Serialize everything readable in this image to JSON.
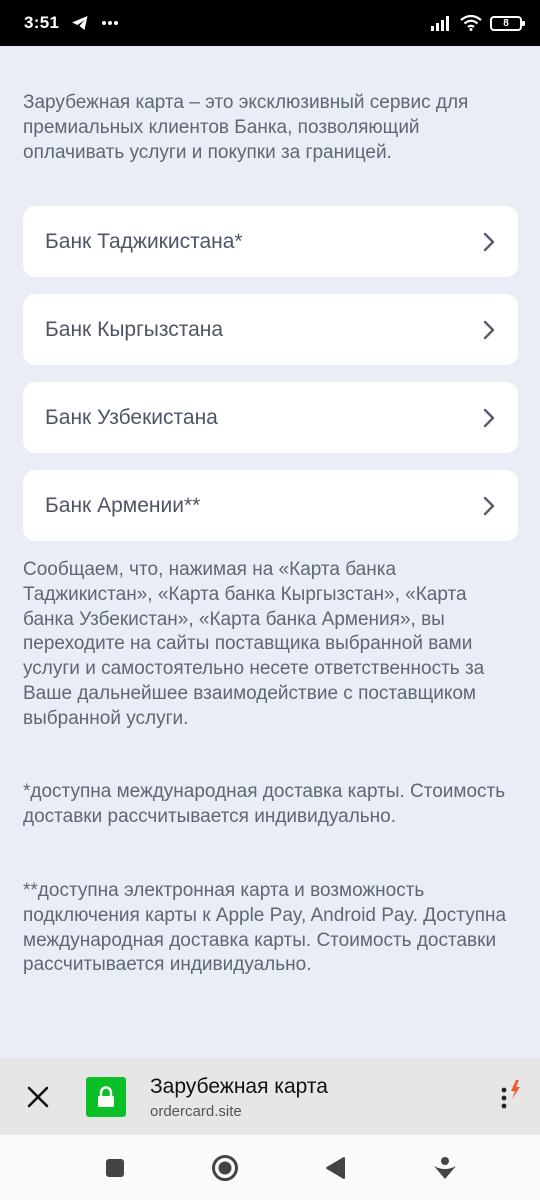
{
  "status_bar": {
    "time": "3:51",
    "battery": "8",
    "icons": [
      "telegram-icon",
      "more-icon",
      "signal-icon",
      "wifi-icon",
      "battery-icon"
    ]
  },
  "intro_text": "Зарубежная карта – это эксклюзивный сервис для премиальных клиентов Банка, позволяющий оплачивать услуги и покупки за границей.",
  "banks": [
    {
      "label": "Банк Таджикистана*"
    },
    {
      "label": "Банк Кыргызстана"
    },
    {
      "label": "Банк Узбекистана"
    },
    {
      "label": "Банк Армении**"
    }
  ],
  "notice": {
    "main": "Сообщаем, что, нажимая на «Карта банка Таджикистан», «Карта банка Кыргызстан», «Карта банка Узбекистан», «Карта банка Армения», вы переходите на сайты поставщика выбранной вами услуги и самостоятельно несете ответственность за Ваше дальнейшее взаимодействие с поставщиком выбранной услуги.",
    "footnote1": "*доступна международная доставка карты. Стоимость доставки рассчитывается индивидуально.",
    "footnote2": "**доступна электронная карта и возможность подключения карты к Apple Pay, Android Pay. Доступна международная доставка карты. Стоимость доставки рассчитывается индивидуально."
  },
  "address_bar": {
    "title": "Зарубежная карта",
    "url": "ordercard.site"
  },
  "colors": {
    "page_bg": "#e9edf5",
    "card_bg": "#ffffff",
    "text": "#5f6675",
    "lock_green": "#0bbf26",
    "accent_orange": "#f05a28"
  }
}
